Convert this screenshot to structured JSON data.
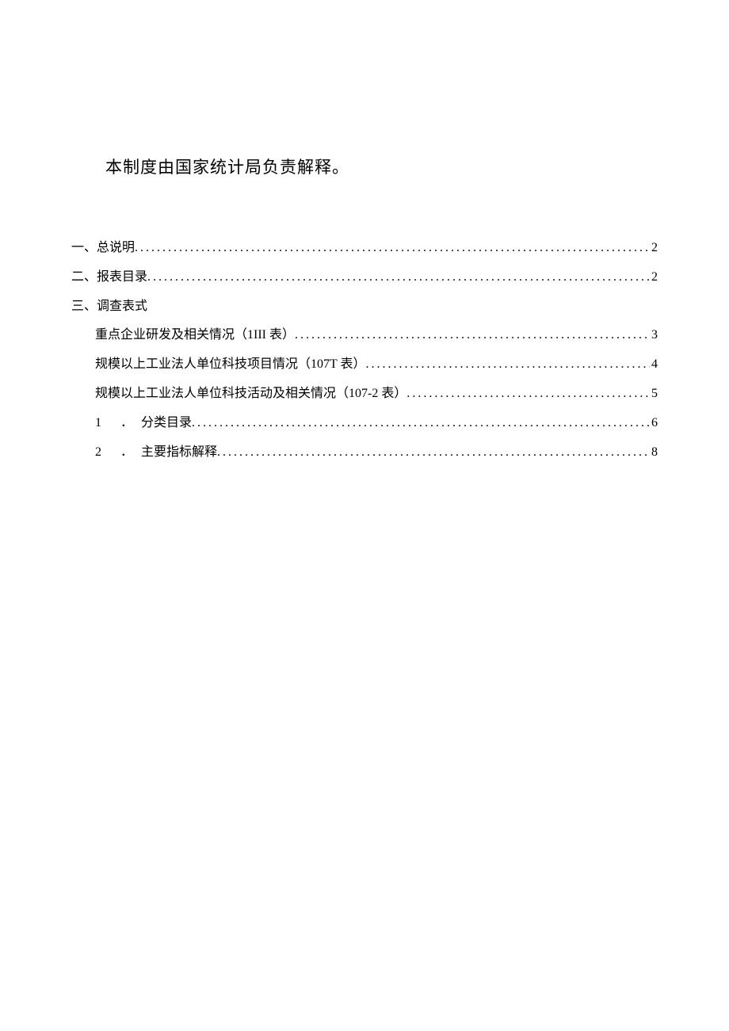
{
  "intro": "本制度由国家统计局负责解释。",
  "toc": {
    "item1": {
      "label": "一、总说明",
      "page": "2"
    },
    "item2": {
      "label": "二、报表目录",
      "page": "2"
    },
    "item3": {
      "label": "三、调查表式"
    },
    "sub1": {
      "label": "重点企业研发及相关情况（1III 表）",
      "page": "3"
    },
    "sub2": {
      "label": "规模以上工业法人单位科技项目情况（107T 表）",
      "page": "4"
    },
    "sub3": {
      "label": "规模以上工业法人单位科技活动及相关情况（107-2 表）",
      "page": "5"
    },
    "sub4": {
      "num": "1",
      "dot": "．",
      "label": "分类目录",
      "page": "6"
    },
    "sub5": {
      "num": "2",
      "dot": "．",
      "label": "主要指标解释",
      "page": "8"
    }
  }
}
